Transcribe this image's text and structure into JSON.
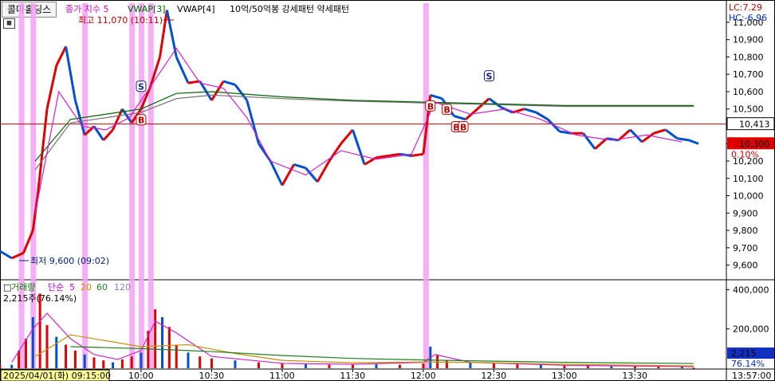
{
  "symbol_tab": "콜마홀딩스",
  "header": {
    "legend_indicator": "종가 지수 5",
    "legend_vwap3": "VWAP[3]",
    "legend_vwap4": "VWAP[4]",
    "legend_pattern": "10억/50억봉 강세패턴  약세패턴",
    "lc": "LC:7.29",
    "hc": "HC:-6.96",
    "high_note": "최고 11,070 (10:11)",
    "low_note": "최저 9,600 (09:02)"
  },
  "price_tags": {
    "ref_price": "10,413",
    "last_price": "10,300",
    "last_change": "0.10%"
  },
  "volume_legend": {
    "title": "거래량",
    "ma_label": "단순",
    "ma5": "5",
    "ma20": "20",
    "ma60": "60",
    "ma120": "120",
    "value": "2,215주(76.14%)"
  },
  "volume_tags": {
    "value": "2,215",
    "pct": "76.14%"
  },
  "time_labels": {
    "start": "2025/04/01(화) 09:15:00",
    "end": "13:57:00"
  },
  "colors": {
    "up": "#e00000",
    "down": "#0050d0",
    "band": "#f5a0f5",
    "ref_line": "#d00000",
    "last_tag": "#e00000",
    "vol_tag": "#1030c0"
  },
  "markers": [
    {
      "kind": "S",
      "time": "10:00"
    },
    {
      "kind": "B",
      "time": "10:00"
    },
    {
      "kind": "B",
      "time": "12:03"
    },
    {
      "kind": "B",
      "time": "12:10"
    },
    {
      "kind": "B",
      "time": "12:14"
    },
    {
      "kind": "B",
      "time": "12:17"
    },
    {
      "kind": "S",
      "time": "12:28"
    }
  ],
  "chart_data": {
    "type": "line",
    "x_axis_ticks": [
      "10:00",
      "10:30",
      "11:00",
      "11:30",
      "12:00",
      "12:30",
      "13:00",
      "13:30"
    ],
    "y_ticks": [
      "11,000",
      "10,900",
      "10,800",
      "10,700",
      "10,600",
      "10,500",
      "10,300",
      "10,200",
      "10,100",
      "10,000",
      "9,900",
      "9,800",
      "9,700",
      "9,600"
    ],
    "ylim": [
      9520,
      11110
    ],
    "price_series": {
      "times": [
        "09:00",
        "09:05",
        "09:10",
        "09:14",
        "09:16",
        "09:20",
        "09:24",
        "09:28",
        "09:32",
        "09:36",
        "09:40",
        "09:44",
        "09:48",
        "09:52",
        "09:56",
        "10:00",
        "10:04",
        "10:08",
        "10:11",
        "10:15",
        "10:20",
        "10:25",
        "10:30",
        "10:35",
        "10:40",
        "10:45",
        "10:50",
        "10:55",
        "11:00",
        "11:05",
        "11:10",
        "11:15",
        "11:20",
        "11:25",
        "11:30",
        "11:35",
        "11:40",
        "11:45",
        "11:50",
        "11:55",
        "12:00",
        "12:03",
        "12:08",
        "12:13",
        "12:18",
        "12:23",
        "12:28",
        "12:33",
        "12:38",
        "12:43",
        "12:48",
        "12:53",
        "12:58",
        "13:03",
        "13:08",
        "13:13",
        "13:18",
        "13:23",
        "13:28",
        "13:33",
        "13:38",
        "13:43",
        "13:48",
        "13:53",
        "13:57"
      ],
      "values": [
        9680,
        9640,
        9670,
        9800,
        10000,
        10500,
        10750,
        10860,
        10550,
        10350,
        10400,
        10320,
        10380,
        10500,
        10420,
        10500,
        10630,
        10800,
        11070,
        10800,
        10650,
        10660,
        10550,
        10660,
        10640,
        10550,
        10300,
        10200,
        10060,
        10180,
        10160,
        10080,
        10200,
        10300,
        10380,
        10180,
        10220,
        10230,
        10240,
        10230,
        10240,
        10580,
        10560,
        10460,
        10440,
        10500,
        10560,
        10510,
        10480,
        10500,
        10480,
        10440,
        10370,
        10360,
        10360,
        10270,
        10330,
        10320,
        10380,
        10310,
        10360,
        10380,
        10330,
        10320,
        10300
      ]
    },
    "vwap3": {
      "times": [
        "09:15",
        "09:30",
        "10:00",
        "10:15",
        "10:30",
        "11:00",
        "11:30",
        "12:00",
        "12:30",
        "13:00",
        "13:30",
        "13:55"
      ],
      "values": [
        10200,
        10440,
        10500,
        10590,
        10600,
        10570,
        10550,
        10540,
        10530,
        10520,
        10520,
        10520
      ]
    },
    "vwap4": {
      "times": [
        "09:15",
        "09:30",
        "10:00",
        "10:15",
        "10:30",
        "11:00",
        "11:30",
        "12:00",
        "12:30",
        "13:00",
        "13:30",
        "13:55"
      ],
      "values": [
        10150,
        10420,
        10480,
        10560,
        10580,
        10560,
        10545,
        10535,
        10525,
        10515,
        10515,
        10515
      ]
    },
    "price_ma5": {
      "times": [
        "09:15",
        "09:25",
        "09:35",
        "09:45",
        "09:55",
        "10:05",
        "10:15",
        "10:25",
        "10:35",
        "10:45",
        "10:55",
        "11:10",
        "11:25",
        "11:40",
        "11:55",
        "12:05",
        "12:20",
        "12:35",
        "12:50",
        "13:05",
        "13:20",
        "13:35",
        "13:50"
      ],
      "values": [
        9900,
        10600,
        10400,
        10380,
        10450,
        10650,
        10850,
        10650,
        10620,
        10450,
        10200,
        10120,
        10260,
        10210,
        10240,
        10540,
        10470,
        10500,
        10440,
        10350,
        10320,
        10350,
        10310
      ]
    },
    "reference_line": 10413,
    "highlight_bands": [
      "09:09",
      "09:14",
      "09:36",
      "09:56",
      "10:00",
      "10:04",
      "12:01"
    ],
    "volume": {
      "ylim": [
        0,
        430000
      ],
      "y_ticks": [
        "400,000",
        "200,000"
      ],
      "times": [
        "09:00",
        "09:05",
        "09:08",
        "09:11",
        "09:14",
        "09:17",
        "09:20",
        "09:24",
        "09:28",
        "09:32",
        "09:36",
        "09:40",
        "09:44",
        "09:48",
        "09:52",
        "09:56",
        "10:00",
        "10:03",
        "10:06",
        "10:09",
        "10:12",
        "10:15",
        "10:20",
        "10:25",
        "10:30",
        "10:40",
        "10:50",
        "11:00",
        "11:10",
        "11:20",
        "11:30",
        "11:40",
        "11:50",
        "12:00",
        "12:03",
        "12:06",
        "12:10",
        "12:20",
        "12:30",
        "12:40",
        "12:50",
        "13:00",
        "13:10",
        "13:20",
        "13:30",
        "13:40",
        "13:50",
        "13:55"
      ],
      "values": [
        12000,
        18000,
        90000,
        150000,
        260000,
        380000,
        220000,
        160000,
        120000,
        90000,
        70000,
        55000,
        40000,
        30000,
        45000,
        60000,
        80000,
        190000,
        300000,
        260000,
        210000,
        120000,
        80000,
        60000,
        50000,
        40000,
        30000,
        25000,
        20000,
        18000,
        22000,
        20000,
        18000,
        24000,
        110000,
        70000,
        40000,
        30000,
        25000,
        22000,
        18000,
        15000,
        20000,
        14000,
        12000,
        10000,
        8000,
        2215
      ]
    },
    "volume_ma5": {
      "times": [
        "09:05",
        "09:14",
        "09:20",
        "09:30",
        "09:40",
        "09:50",
        "10:00",
        "10:06",
        "10:15",
        "10:30",
        "11:00",
        "11:30",
        "12:00",
        "12:05",
        "12:20",
        "13:00",
        "13:55"
      ],
      "values": [
        30000,
        200000,
        280000,
        150000,
        70000,
        45000,
        90000,
        240000,
        180000,
        60000,
        25000,
        20000,
        30000,
        70000,
        30000,
        15000,
        8000
      ]
    },
    "volume_ma20": {
      "times": [
        "09:15",
        "09:30",
        "10:00",
        "10:20",
        "10:40",
        "11:00",
        "11:30",
        "12:00",
        "12:30",
        "13:00",
        "13:55"
      ],
      "values": [
        60000,
        170000,
        110000,
        120000,
        75000,
        40000,
        28000,
        32000,
        28000,
        20000,
        12000
      ]
    },
    "volume_ma60": {
      "times": [
        "09:30",
        "10:00",
        "10:30",
        "11:00",
        "11:30",
        "12:00",
        "12:30",
        "13:00",
        "13:55"
      ],
      "values": [
        110000,
        100000,
        85000,
        65000,
        50000,
        42000,
        36000,
        30000,
        24000
      ]
    }
  }
}
